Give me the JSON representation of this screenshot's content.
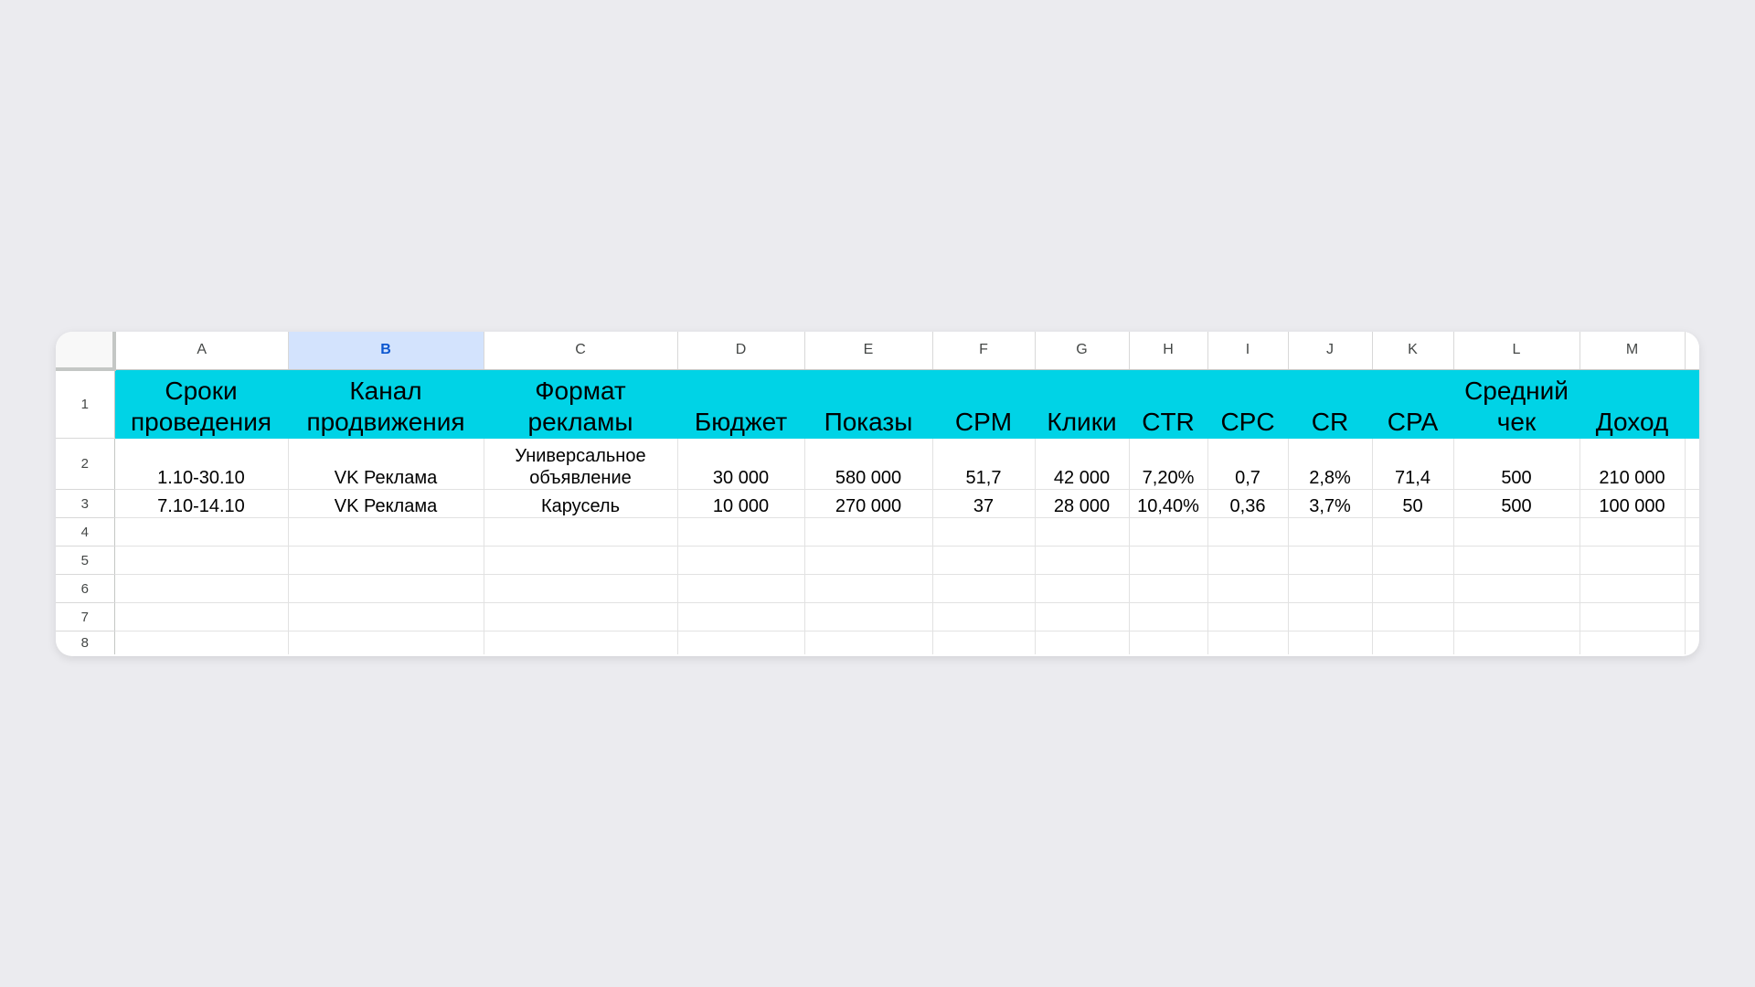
{
  "sheet": {
    "columns": [
      "A",
      "B",
      "C",
      "D",
      "E",
      "F",
      "G",
      "H",
      "I",
      "J",
      "K",
      "L",
      "M"
    ],
    "selected_column": "B",
    "row_numbers": [
      "1",
      "2",
      "3",
      "4",
      "5",
      "6",
      "7",
      "8"
    ],
    "header": [
      [
        "Сроки",
        "проведения"
      ],
      [
        "Канал",
        "продвижения"
      ],
      [
        "Формат",
        "рекламы"
      ],
      [
        "Бюджет"
      ],
      [
        "Показы"
      ],
      [
        "CPM"
      ],
      [
        "Клики"
      ],
      [
        "CTR"
      ],
      [
        "CPC"
      ],
      [
        "CR"
      ],
      [
        "CPA"
      ],
      [
        "Средний",
        "чек"
      ],
      [
        "Доход"
      ]
    ],
    "rows": [
      [
        "1.10-30.10",
        "VK Реклама",
        [
          "Универсальное",
          "объявление"
        ],
        "30 000",
        "580 000",
        "51,7",
        "42 000",
        "7,20%",
        "0,7",
        "2,8%",
        "71,4",
        "500",
        "210 000"
      ],
      [
        "7.10-14.10",
        "VK Реклама",
        [
          "Карусель"
        ],
        "10 000",
        "270 000",
        "37",
        "28 000",
        "10,40%",
        "0,36",
        "3,7%",
        "50",
        "500",
        "100 000"
      ]
    ],
    "header_fill_color": "#00d3e6",
    "selected_column_color": "#d3e3fd"
  }
}
